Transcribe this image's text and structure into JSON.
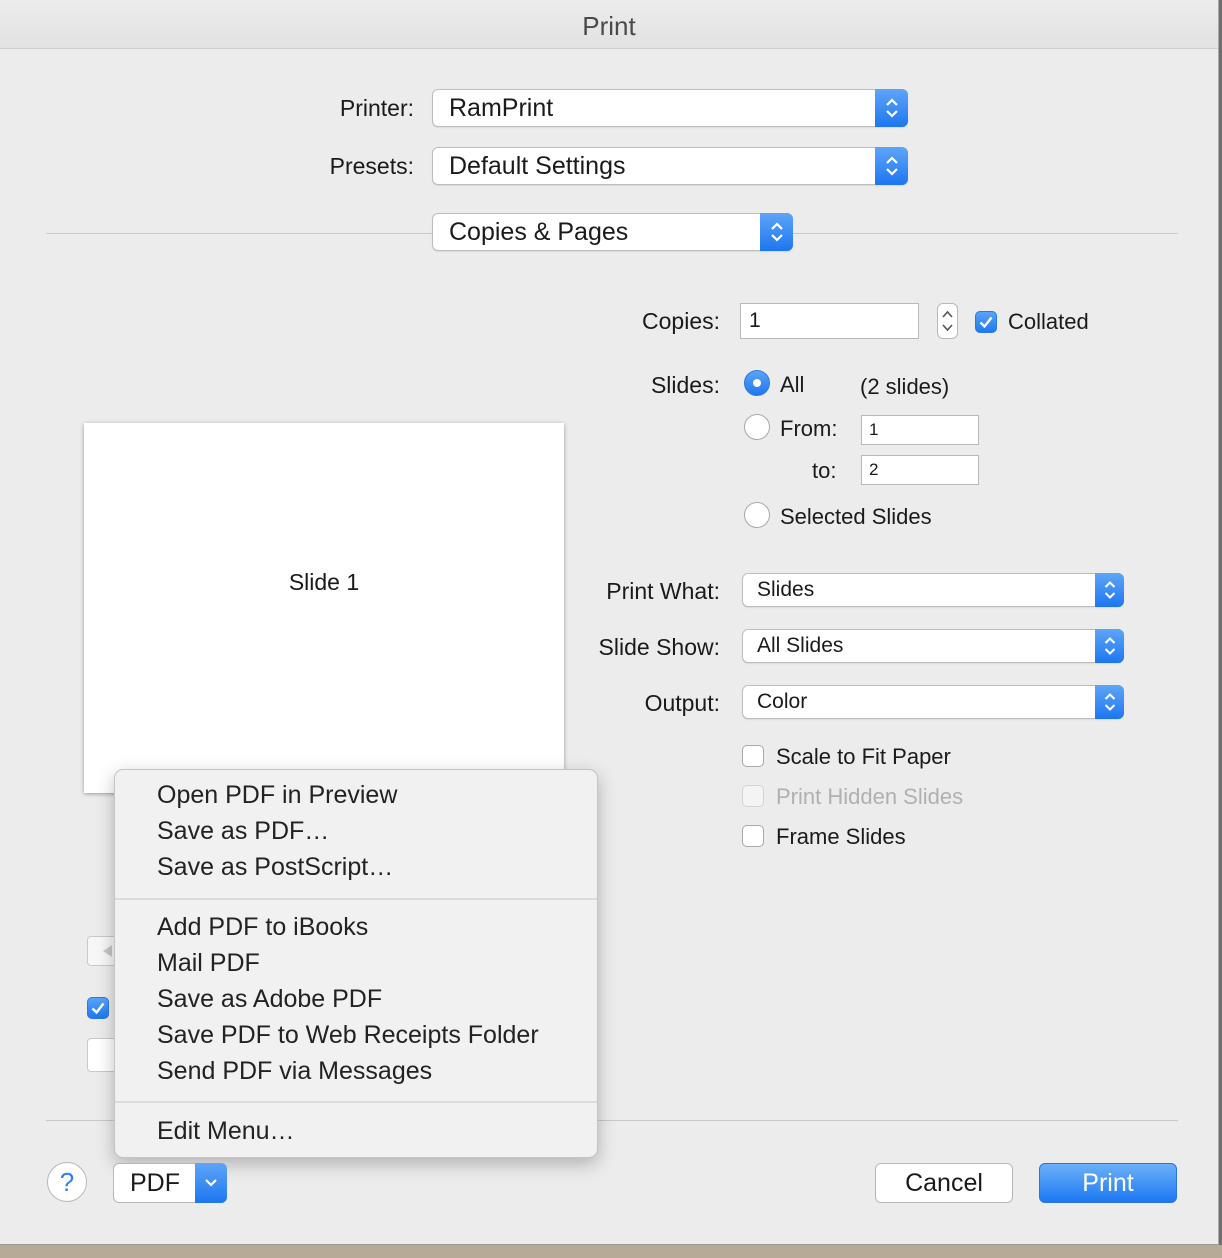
{
  "window": {
    "title": "Print"
  },
  "printer": {
    "label": "Printer:",
    "value": "RamPrint"
  },
  "presets": {
    "label": "Presets:",
    "value": "Default Settings"
  },
  "section": {
    "value": "Copies & Pages"
  },
  "copies": {
    "label": "Copies:",
    "value": "1",
    "collated_label": "Collated",
    "collated": true
  },
  "slides": {
    "label": "Slides:",
    "all_label": "All",
    "count_text": "(2 slides)",
    "from_label": "From:",
    "from_value": "1",
    "to_label": "to:",
    "to_value": "2",
    "selected_label": "Selected Slides"
  },
  "print_what": {
    "label": "Print What:",
    "value": "Slides"
  },
  "slide_show": {
    "label": "Slide Show:",
    "value": "All Slides"
  },
  "output": {
    "label": "Output:",
    "value": "Color"
  },
  "options": {
    "scale_to_fit": "Scale to Fit Paper",
    "print_hidden": "Print Hidden Slides",
    "frame_slides": "Frame Slides"
  },
  "preview": {
    "text": "Slide 1"
  },
  "pdf_menu": {
    "group1": [
      "Open PDF in Preview",
      "Save as PDF…",
      "Save as PostScript…"
    ],
    "group2": [
      "Add PDF to iBooks",
      "Mail PDF",
      "Save as Adobe PDF",
      "Save PDF to Web Receipts Folder",
      "Send PDF via Messages"
    ],
    "group3": [
      "Edit Menu…"
    ]
  },
  "footer": {
    "help": "?",
    "pdf": "PDF",
    "cancel": "Cancel",
    "print": "Print"
  },
  "colors": {
    "accent": "#1f78f0",
    "dialog_bg": "#ececec"
  },
  "icons": {
    "popup": "up-down-chevron-icon",
    "checkmark": "checkmark-icon",
    "help": "question-icon",
    "pdf_menu": "chevron-down-icon"
  }
}
